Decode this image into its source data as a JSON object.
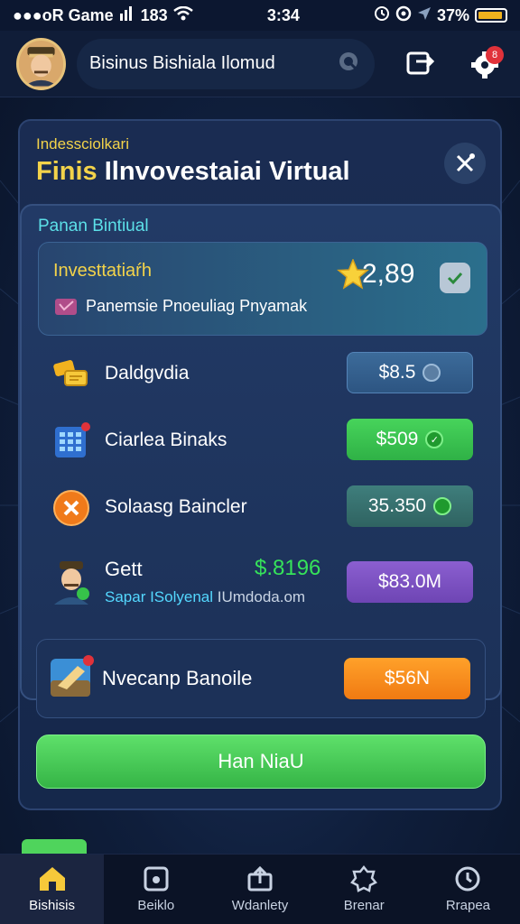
{
  "status_bar": {
    "carrier": "●●●oR Game",
    "time_left": "183",
    "time_center": "3:34",
    "battery": "37%"
  },
  "header": {
    "account_name": "Bisinus Bishiala Ilomud"
  },
  "panel": {
    "subtitle": "Indessciolkari",
    "title_accent": "Finis",
    "title_rest": " Ilnvovestaiai Virtual",
    "inner_label": "Panan Bintiual",
    "investment": {
      "title": "Investtatiaŕh",
      "value": "2,89",
      "description": "Panemsie Pnoeuliag Pnyamak"
    },
    "rows": [
      {
        "label": "Daldgvdia",
        "button": "$8.5"
      },
      {
        "label": "Ciarlea Binaks",
        "button": "$509"
      },
      {
        "label": "Solaasg Baincler",
        "button": "35.350"
      }
    ],
    "get_row": {
      "label": "Gett",
      "amount": "$.8196",
      "sub_highlight": "Sapar ISolyenal",
      "sub_rest": " IUmdoda.om",
      "button": "$83.0M"
    },
    "bonus": {
      "label": "Nvecanp Banoile",
      "button": "$56N"
    },
    "primary_button": "Han NiaU"
  },
  "bottom_nav": [
    {
      "label": "Bishisis",
      "icon": "home-icon"
    },
    {
      "label": "Beiklo",
      "icon": "wallet-icon"
    },
    {
      "label": "Wdanlety",
      "icon": "upload-icon"
    },
    {
      "label": "Brenar",
      "icon": "badge-icon"
    },
    {
      "label": "Rrapea",
      "icon": "clock-icon"
    }
  ],
  "colors": {
    "accent_yellow": "#f3d34a",
    "accent_green": "#36e35a",
    "accent_cyan": "#5ce0e8"
  }
}
